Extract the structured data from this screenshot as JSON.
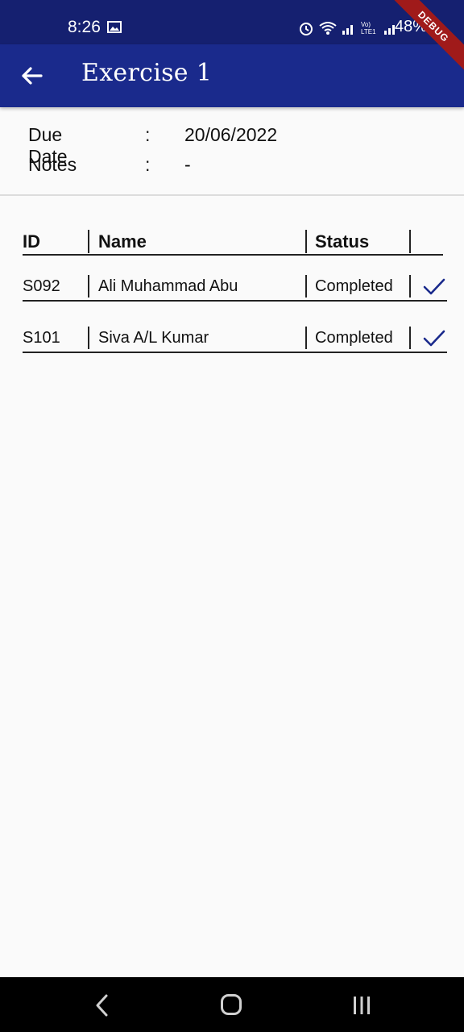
{
  "status_bar": {
    "time": "8:26",
    "battery": "48%",
    "network_label": "Vo) LTE1"
  },
  "debug_banner": "DEBUG",
  "app_bar": {
    "title": "Exercise 1"
  },
  "info": {
    "due_date": {
      "label": "Due Date",
      "separator": ":",
      "value": "20/06/2022"
    },
    "notes": {
      "label": "Notes",
      "separator": ":",
      "value": "-"
    }
  },
  "table": {
    "headers": {
      "id": "ID",
      "name": "Name",
      "status": "Status"
    },
    "rows": [
      {
        "id": "S092",
        "name": "Ali Muhammad Abu",
        "status": "Completed",
        "icon": "check-icon"
      },
      {
        "id": "S101",
        "name": "Siva A/L Kumar",
        "status": "Completed",
        "icon": "check-icon"
      }
    ]
  },
  "colors": {
    "app_bar": "#1a2a8c",
    "status_bar": "#152070",
    "check": "#1a2a8c",
    "debug_ribbon": "#a01a1a"
  }
}
